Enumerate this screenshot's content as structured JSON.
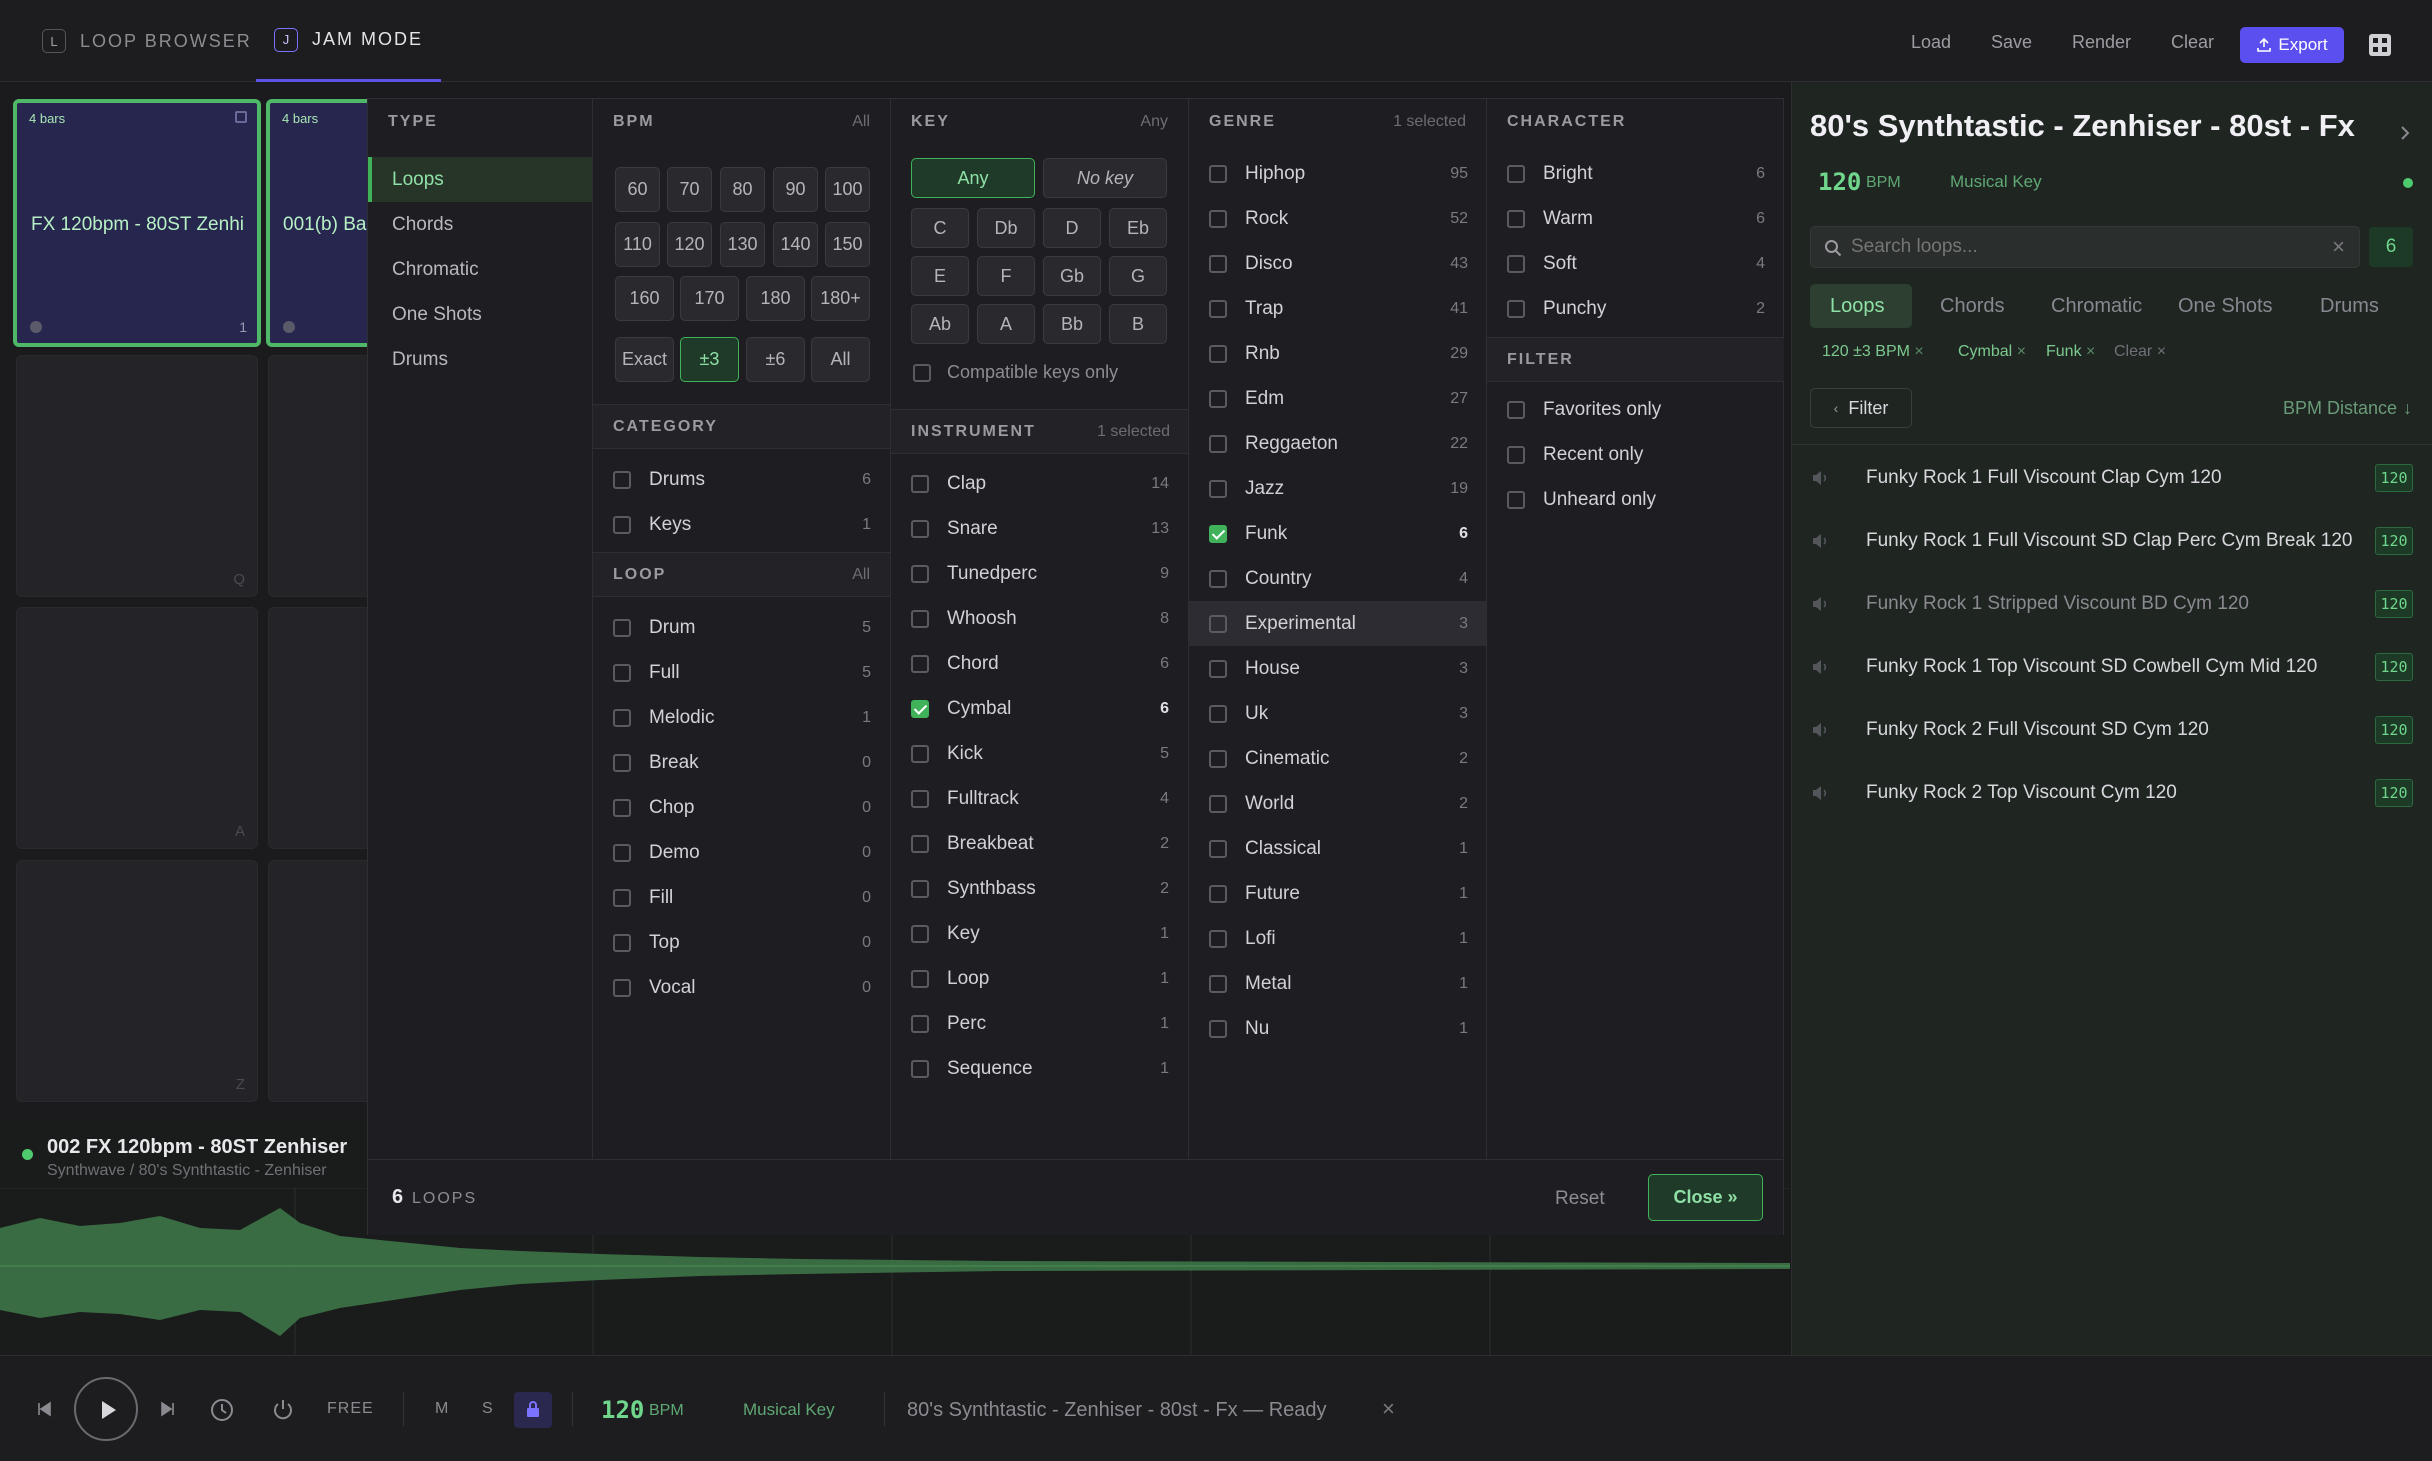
{
  "top_tabs": [
    {
      "key": "L",
      "label": "LOOP BROWSER"
    },
    {
      "key": "J",
      "label": "JAM MODE"
    }
  ],
  "toolbar": {
    "load": "Load",
    "save": "Save",
    "render": "Render",
    "clear": "Clear",
    "export": "Export"
  },
  "pads": [
    {
      "bars": "4 bars",
      "name": "FX 120bpm - 80ST Zenhi",
      "num": "1"
    },
    {
      "bars": "4 bars",
      "name": "001(b) Ba"
    }
  ],
  "pad_keys": [
    "Q",
    "A",
    "Z"
  ],
  "panel": {
    "type": {
      "header": "TYPE",
      "items": [
        "Loops",
        "Chords",
        "Chromatic",
        "One Shots",
        "Drums"
      ],
      "active": "Loops"
    },
    "bpm": {
      "header": "BPM",
      "sub": "All",
      "values": [
        "60",
        "70",
        "80",
        "90",
        "100",
        "110",
        "120",
        "130",
        "140",
        "150",
        "160",
        "170",
        "180",
        "180+"
      ],
      "ranges": [
        "Exact",
        "±3",
        "±6",
        "All"
      ],
      "selected_range": "±3"
    },
    "category": {
      "header": "CATEGORY",
      "items": [
        {
          "label": "Drums",
          "count": "6"
        },
        {
          "label": "Keys",
          "count": "1"
        }
      ]
    },
    "loop": {
      "header": "LOOP",
      "sub": "All",
      "items": [
        {
          "label": "Drum",
          "count": "5"
        },
        {
          "label": "Full",
          "count": "5"
        },
        {
          "label": "Melodic",
          "count": "1"
        },
        {
          "label": "Break",
          "count": "0"
        },
        {
          "label": "Chop",
          "count": "0"
        },
        {
          "label": "Demo",
          "count": "0"
        },
        {
          "label": "Fill",
          "count": "0"
        },
        {
          "label": "Top",
          "count": "0"
        },
        {
          "label": "Vocal",
          "count": "0"
        }
      ]
    },
    "key": {
      "header": "KEY",
      "sub": "Any",
      "any": "Any",
      "nokey": "No key",
      "keys": [
        "C",
        "Db",
        "D",
        "Eb",
        "E",
        "F",
        "Gb",
        "G",
        "Ab",
        "A",
        "Bb",
        "B"
      ],
      "compatible": "Compatible keys only"
    },
    "instrument": {
      "header": "INSTRUMENT",
      "sub": "1 selected",
      "items": [
        {
          "label": "Clap",
          "count": "14"
        },
        {
          "label": "Snare",
          "count": "13"
        },
        {
          "label": "Tunedperc",
          "count": "9"
        },
        {
          "label": "Whoosh",
          "count": "8"
        },
        {
          "label": "Chord",
          "count": "6"
        },
        {
          "label": "Cymbal",
          "count": "6",
          "checked": true
        },
        {
          "label": "Kick",
          "count": "5"
        },
        {
          "label": "Fulltrack",
          "count": "4"
        },
        {
          "label": "Breakbeat",
          "count": "2"
        },
        {
          "label": "Synthbass",
          "count": "2"
        },
        {
          "label": "Key",
          "count": "1"
        },
        {
          "label": "Loop",
          "count": "1"
        },
        {
          "label": "Perc",
          "count": "1"
        },
        {
          "label": "Sequence",
          "count": "1"
        }
      ]
    },
    "genre": {
      "header": "GENRE",
      "sub": "1 selected",
      "items": [
        {
          "label": "Hiphop",
          "count": "95"
        },
        {
          "label": "Rock",
          "count": "52"
        },
        {
          "label": "Disco",
          "count": "43"
        },
        {
          "label": "Trap",
          "count": "41"
        },
        {
          "label": "Rnb",
          "count": "29"
        },
        {
          "label": "Edm",
          "count": "27"
        },
        {
          "label": "Reggaeton",
          "count": "22"
        },
        {
          "label": "Jazz",
          "count": "19"
        },
        {
          "label": "Funk",
          "count": "6",
          "checked": true
        },
        {
          "label": "Country",
          "count": "4"
        },
        {
          "label": "Experimental",
          "count": "3",
          "hover": true
        },
        {
          "label": "House",
          "count": "3"
        },
        {
          "label": "Uk",
          "count": "3"
        },
        {
          "label": "Cinematic",
          "count": "2"
        },
        {
          "label": "World",
          "count": "2"
        },
        {
          "label": "Classical",
          "count": "1"
        },
        {
          "label": "Future",
          "count": "1"
        },
        {
          "label": "Lofi",
          "count": "1"
        },
        {
          "label": "Metal",
          "count": "1"
        },
        {
          "label": "Nu",
          "count": "1"
        }
      ]
    },
    "character": {
      "header": "CHARACTER",
      "items": [
        {
          "label": "Bright",
          "count": "6"
        },
        {
          "label": "Warm",
          "count": "6"
        },
        {
          "label": "Soft",
          "count": "4"
        },
        {
          "label": "Punchy",
          "count": "2"
        }
      ]
    },
    "filter": {
      "header": "FILTER",
      "items": [
        "Favorites only",
        "Recent only",
        "Unheard only"
      ]
    },
    "footer": {
      "count": "6",
      "unit": "LOOPS",
      "reset": "Reset",
      "close": "Close »"
    }
  },
  "right": {
    "title": "80's Synthtastic - Zenhiser - 80st - Fx",
    "bpm": "120",
    "bpm_unit": "BPM",
    "key": "Musical Key",
    "search_placeholder": "Search loops...",
    "result_count": "6",
    "tabs": [
      "Loops",
      "Chords",
      "Chromatic",
      "One Shots",
      "Drums"
    ],
    "active_tab": "Loops",
    "chips": [
      "120 ±3 BPM",
      "Cymbal",
      "Funk",
      "Clear"
    ],
    "filter_btn": "Filter",
    "sort": "BPM Distance",
    "results": [
      {
        "name": "Funky Rock 1 Full Viscount Clap Cym 120",
        "bpm": "120"
      },
      {
        "name": "Funky Rock 1 Full Viscount SD Clap Perc Cym Break 120",
        "bpm": "120"
      },
      {
        "name": "Funky Rock 1 Stripped Viscount BD Cym 120",
        "bpm": "120",
        "dim": true
      },
      {
        "name": "Funky Rock 1 Top Viscount SD Cowbell Cym Mid 120",
        "bpm": "120"
      },
      {
        "name": "Funky Rock 2 Full Viscount SD Cym 120",
        "bpm": "120"
      },
      {
        "name": "Funky Rock 2 Top Viscount Cym 120",
        "bpm": "120"
      }
    ]
  },
  "track": {
    "title": "002 FX 120bpm - 80ST Zenhiser",
    "path": "Synthwave / 80's Synthtastic - Zenhiser"
  },
  "transport": {
    "free": "FREE",
    "m": "M",
    "s": "S",
    "bpm": "120",
    "bpm_unit": "BPM",
    "key": "Musical Key",
    "status": "80's Synthtastic - Zenhiser - 80st - Fx — Ready"
  },
  "colors": {
    "accent": "#5b4ff0",
    "green": "#3fb25a"
  }
}
